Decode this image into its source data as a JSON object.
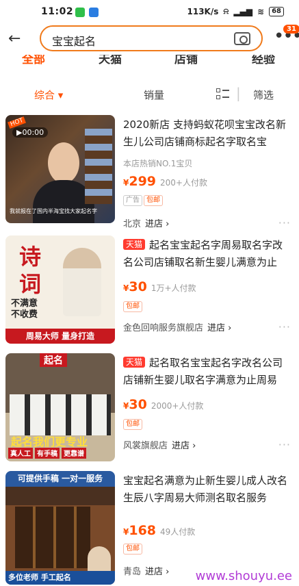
{
  "status": {
    "time": "11:02",
    "net": "113K/s",
    "battery": "68"
  },
  "search": {
    "query": "宝宝起名",
    "badge": "31"
  },
  "tabs": [
    "全部",
    "天猫",
    "店铺",
    "经验"
  ],
  "sort": {
    "composite": "综合 ▾",
    "sales": "销量",
    "filter": "筛选"
  },
  "items": [
    {
      "title": "2020新店 支持蚂蚁花呗宝宝改名新生儿公司店铺商标起名字取名宝",
      "sub": "本店热销NO.1宝贝",
      "price": "299",
      "sold": "200+人付款",
      "tags": [
        "广告",
        "包邮"
      ],
      "shop": "北京",
      "enter": "进店 ›",
      "video": "00:00",
      "caption": "我就报在了国内半海宝找大家起名字"
    },
    {
      "tmall": "天猫",
      "title": "起名宝宝起名字周易取名字改名公司店铺取名新生婴儿满意为止",
      "price": "30",
      "sold": "1万+人付款",
      "tags": [
        "包邮"
      ],
      "shop": "金色回响服务旗舰店",
      "enter": "进店 ›",
      "art": [
        "诗",
        "词",
        "不满意",
        "不收费",
        "周易大师 量身打造"
      ]
    },
    {
      "tmall": "天猫",
      "title": "起名取名宝宝起名字改名公司店铺新生婴儿取名字满意为止周易",
      "price": "30",
      "sold": "2000+人付款",
      "tags": [
        "包邮"
      ],
      "shop": "风裳旗舰店",
      "enter": "进店 ›",
      "art": [
        "起名",
        "起名我们更专业",
        "真人工",
        "有手稿",
        "更靠谱"
      ]
    },
    {
      "title": "宝宝起名满意为止新生婴儿成人改名生辰八字周易大师测名取名服务",
      "price": "168",
      "sold": "49人付款",
      "tags": [
        "包邮"
      ],
      "shop": "青岛",
      "enter": "进店 ›",
      "art": [
        "可提供手稿 一对一服务",
        "多位老师 手工起名"
      ]
    }
  ],
  "watermark": "www.shouyu.ee"
}
